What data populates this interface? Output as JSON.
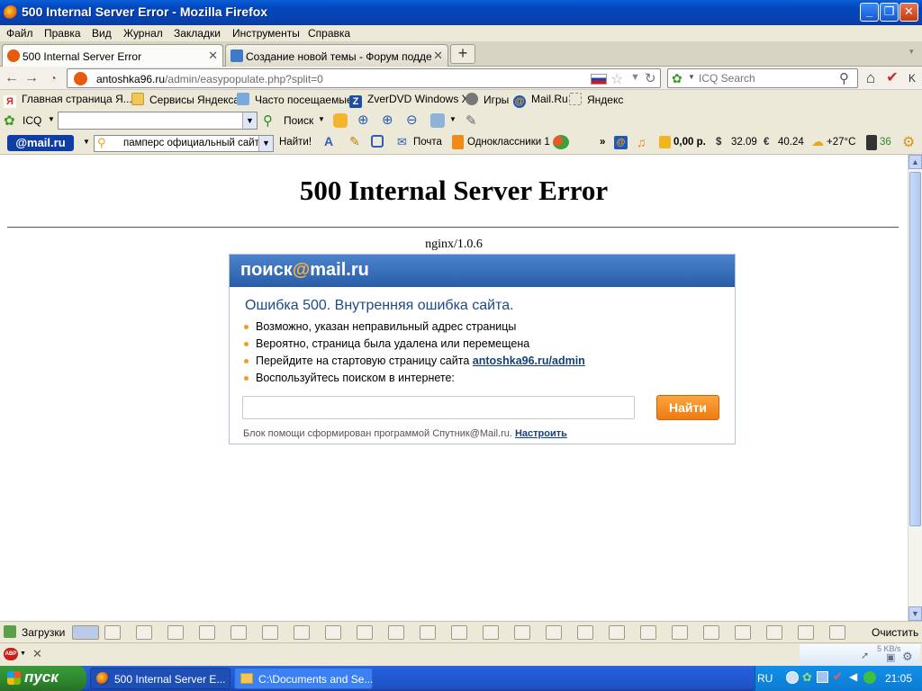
{
  "window": {
    "title": "500 Internal Server Error - Mozilla Firefox"
  },
  "menu": [
    "Файл",
    "Правка",
    "Вид",
    "Журнал",
    "Закладки",
    "Инструменты",
    "Справка"
  ],
  "tabs": [
    {
      "label": "500 Internal Server Error",
      "active": true
    },
    {
      "label": "Создание новой темы - Форум поддер...",
      "active": false
    }
  ],
  "nav": {
    "url_host": "antoshka96.ru",
    "url_path": "/admin/easypopulate.php?split=0",
    "search_placeholder": "ICQ Search"
  },
  "bookmarks": [
    "Главная страница Я...",
    "Сервисы Яндекса",
    "Часто посещаемые",
    "ZverDVD Windows XP",
    "Игры",
    "Mail.Ru",
    "Яндекс"
  ],
  "icq_bar": {
    "label": "ICQ",
    "search_label": "Поиск"
  },
  "mail_bar": {
    "logo": "@mail.ru",
    "search_value": "памперс официальный сайт",
    "find_label": "Найти!",
    "mail_label": "Почта",
    "ok_label": "Одноклассники 1",
    "more": "»",
    "balance": "0,00 р.",
    "usd": "32.09",
    "eur": "40.24",
    "weather": "+27°C",
    "traffic": "36"
  },
  "page": {
    "heading": "500 Internal Server Error",
    "server": "nginx/1.0.6",
    "box": {
      "logo_left": "поиск",
      "logo_at": "@",
      "logo_right": "mail.ru",
      "title": "Ошибка 500. Внутренняя ошибка сайта.",
      "items": [
        "Возможно, указан неправильный адрес страницы",
        "Вероятно, страница была удалена или перемещена",
        "Перейдите на стартовую страницу сайта",
        "Воспользуйтесь поиском в интернете:"
      ],
      "home_link": "antoshka96.ru/admin",
      "button": "Найти",
      "footer": "Блок помощи сформирован программой Спутник@Mail.ru.",
      "footer_link": "Настроить"
    }
  },
  "downloads": {
    "label": "Загрузки",
    "clear": "Очистить",
    "speed": "5 KB/s"
  },
  "taskbar": {
    "start": "пуск",
    "tasks": [
      "500 Internal Server E...",
      "C:\\Documents and Se..."
    ],
    "lang": "RU",
    "clock": "21:05"
  }
}
